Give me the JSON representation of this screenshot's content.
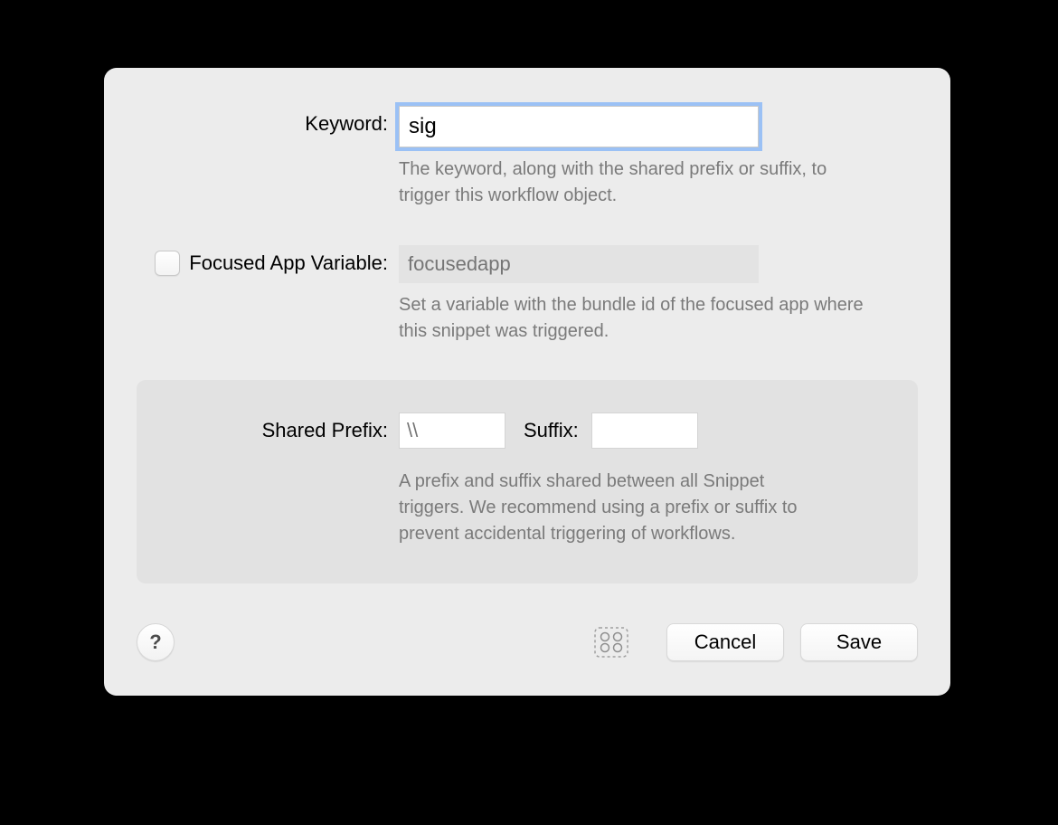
{
  "keyword": {
    "label": "Keyword:",
    "value": "sig",
    "help": "The keyword, along with the shared prefix or suffix, to trigger this workflow object."
  },
  "focused": {
    "checked": false,
    "label": "Focused App Variable:",
    "placeholder": "focusedapp",
    "value": "",
    "help": "Set a variable with the bundle id of the focused app where this snippet was triggered."
  },
  "shared": {
    "label": "Shared Prefix:",
    "prefix_value": "\\\\",
    "suffix_label": "Suffix:",
    "suffix_value": "",
    "help": "A prefix and suffix shared between all Snippet triggers. We recommend using a prefix or suffix to prevent accidental triggering of workflows."
  },
  "footer": {
    "help_icon_label": "?",
    "cancel": "Cancel",
    "save": "Save"
  }
}
